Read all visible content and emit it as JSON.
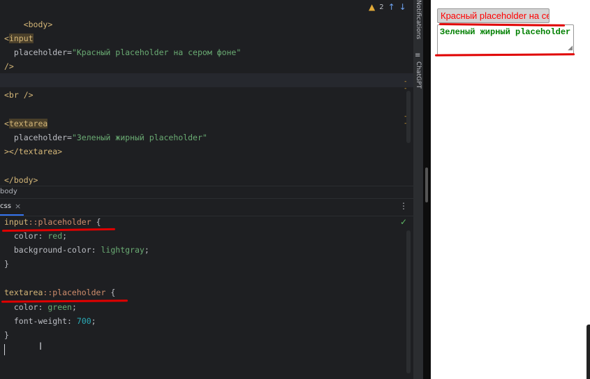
{
  "html_editor": {
    "lines": {
      "body_open": "<body>",
      "input_tag": "input",
      "input_attr": "placeholder=",
      "input_val": "\"Красный placeholder на сером фоне\"",
      "self_close": "/>",
      "br_tag": "<br />",
      "textarea_tag": "textarea",
      "textarea_attr": "placeholder=",
      "textarea_val": "\"Зеленый жирный placeholder\"",
      "textarea_close": "></textarea>",
      "body_close": "</body>"
    },
    "warnings_count": "2"
  },
  "breadcrumb": {
    "item": "body"
  },
  "css_tab": {
    "label": "css",
    "close": "×"
  },
  "css_editor": {
    "rule1_selector": "input",
    "rule1_pseudo": "::placeholder",
    "rule1_open": " {",
    "rule1_prop1": "color",
    "rule1_val1": "red",
    "rule1_prop2": "background-color",
    "rule1_val2": "lightgray",
    "rule2_selector": "textarea",
    "rule2_pseudo": "::placeholder",
    "rule2_open": " {",
    "rule2_prop1": "color",
    "rule2_val1": "green",
    "rule2_prop2": "font-weight",
    "rule2_val2": "700",
    "close_brace": "}"
  },
  "side_panel": {
    "notifications": "Notifications",
    "chatgpt": "ChatGPT"
  },
  "preview": {
    "input_placeholder": "Красный placeholder на сером фоне",
    "textarea_placeholder": "Зеленый жирный placeholder"
  },
  "colors": {
    "annotation": "#e00000",
    "placeholder_red": "#ff0000",
    "placeholder_green": "#008000",
    "input_bg": "#d3d3d3"
  }
}
